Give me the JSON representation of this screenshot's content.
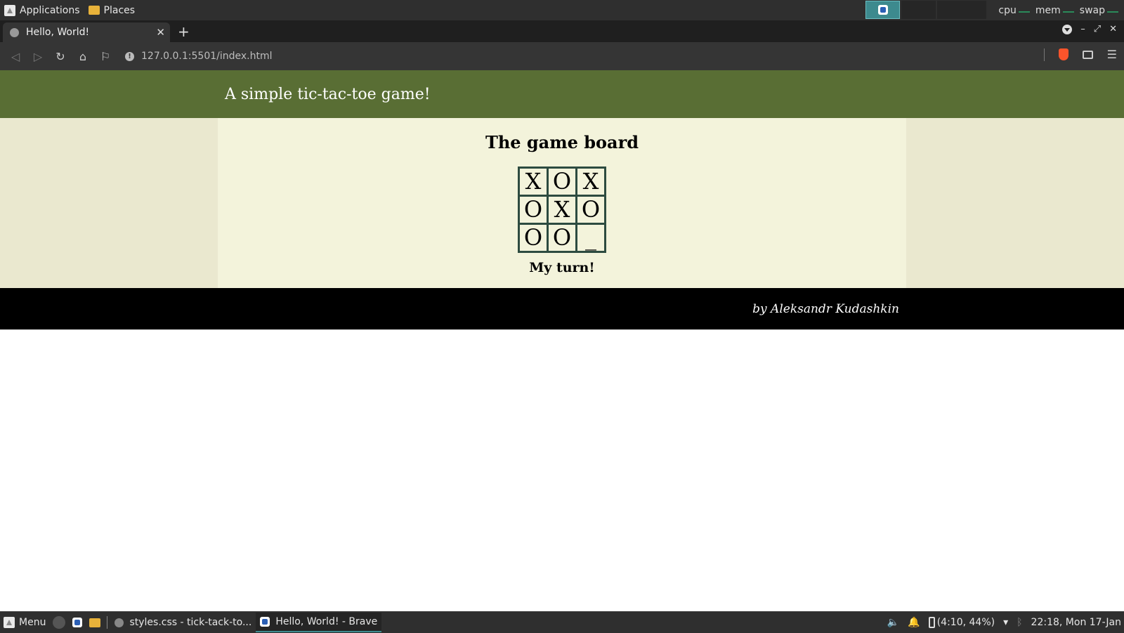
{
  "system_panel": {
    "applications": "Applications",
    "places": "Places",
    "monitors": [
      "cpu",
      "mem",
      "swap"
    ]
  },
  "browser": {
    "tab_title": "Hello, World!",
    "url": "127.0.0.1:5501/index.html"
  },
  "page": {
    "header_title": "A simple tic-tac-toe game!",
    "board_heading": "The game board",
    "board": [
      [
        "X",
        "O",
        "X"
      ],
      [
        "O",
        "X",
        "O"
      ],
      [
        "O",
        "O",
        "_"
      ]
    ],
    "status": "My turn!",
    "footer": "by Aleksandr Kudashkin",
    "colors": {
      "header": "#596e34",
      "main": "#f3f3db",
      "side": "#eae8cf",
      "footer": "#000000",
      "board_border": "#2d4b40"
    }
  },
  "taskbar": {
    "menu": "Menu",
    "tasks": [
      "styles.css - tick-tack-to...",
      "Hello, World! - Brave"
    ],
    "battery": "(4:10, 44%)",
    "clock": "22:18, Mon 17-Jan"
  }
}
